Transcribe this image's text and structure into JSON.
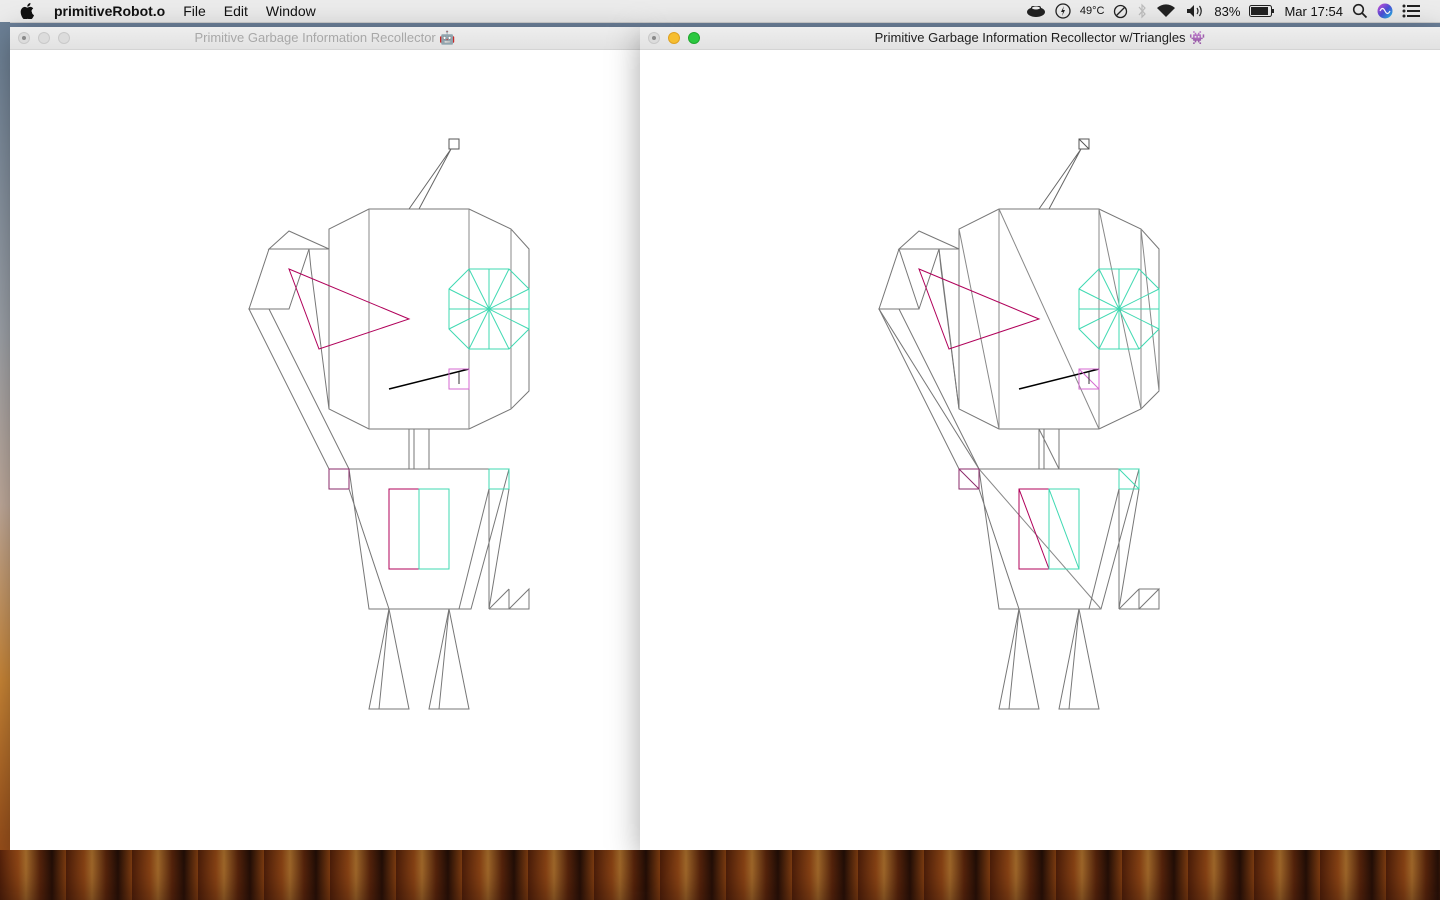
{
  "menubar": {
    "app_name": "primitiveRobot.o",
    "menus": [
      "File",
      "Edit",
      "Window"
    ],
    "temperature": "49°C",
    "battery": "83%",
    "clock": "Mar 17:54",
    "icons": [
      "apple-icon",
      "cpu-monitor-icon",
      "energy-icon",
      "do-not-disturb-icon",
      "bluetooth-icon",
      "wifi-icon",
      "volume-icon",
      "battery-icon",
      "spotlight-search-icon",
      "siri-icon",
      "notification-center-icon"
    ]
  },
  "windows": [
    {
      "title": "Primitive Garbage Information Recollector 🤖",
      "state": "inactive"
    },
    {
      "title": "Primitive Garbage Information Recollector w/Triangles 👾",
      "state": "active"
    }
  ],
  "colors": {
    "outline": "#666666",
    "magenta": "#b0005a",
    "cyan": "#3fd9b2",
    "pink": "#d46ad0",
    "mouth": "#000000"
  }
}
